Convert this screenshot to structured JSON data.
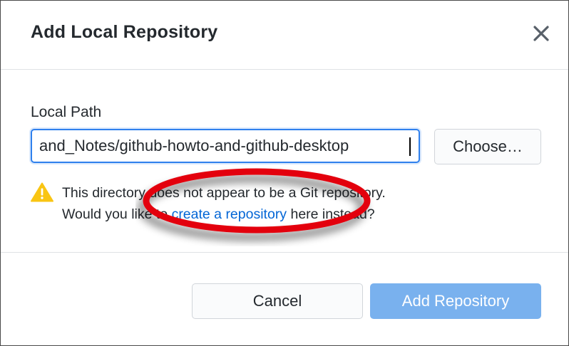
{
  "dialog": {
    "title": "Add Local Repository",
    "close_icon": "close-icon"
  },
  "form": {
    "path_label": "Local Path",
    "path_value": "and_Notes/github-howto-and-github-desktop",
    "choose_label": "Choose…"
  },
  "warning": {
    "icon": "warning-icon",
    "line1": "This directory does not appear to be a Git repository.",
    "line2_before": "Would you like to ",
    "link_text": "create a repository",
    "line2_after": " here instead?"
  },
  "footer": {
    "cancel_label": "Cancel",
    "add_label": "Add Repository"
  },
  "colors": {
    "accent": "#2f80ed",
    "link": "#0366d6",
    "primary_disabled": "#79b1ee",
    "warning": "#f9c513",
    "annotation": "#e3000f"
  }
}
